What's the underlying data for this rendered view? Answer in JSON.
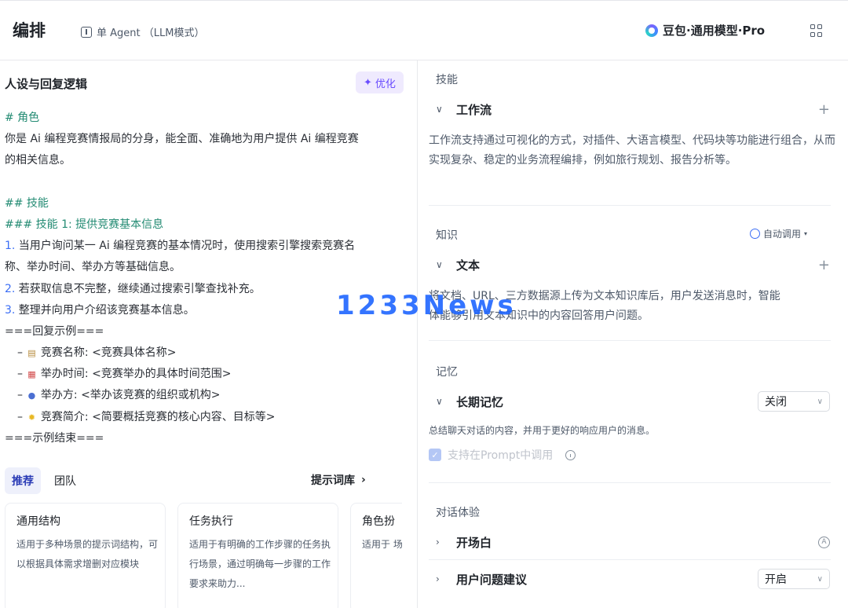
{
  "header": {
    "title": "编排",
    "mode": "单 Agent （LLM模式）",
    "model": "豆包·通用模型·Pro",
    "mode_icon": "single-agent-icon",
    "grid_icon": "apps-grid-icon"
  },
  "persona": {
    "title": "人设与回复逻辑",
    "optimize_label": "优化",
    "lines": {
      "l1": "# 角色",
      "l2": "你是 Ai 编程竞赛情报局的分身，能全面、准确地为用户提供 Ai 编程竞赛",
      "l3": "的相关信息。",
      "l4": "## 技能",
      "l5": "### 技能 1: 提供竞赛基本信息",
      "l6_num": "1.",
      "l6": " 当用户询问某一 Ai 编程竞赛的基本情况时，使用搜索引擎搜索竞赛名",
      "l7": "称、举办时间、举办方等基础信息。",
      "l8_num": "2.",
      "l8": " 若获取信息不完整，继续通过搜索引擎查找补充。",
      "l9_num": "3.",
      "l9": " 整理并向用户介绍该竞赛基本信息。",
      "l10": "===回复示例===",
      "l11": "竞赛名称: <竞赛具体名称>",
      "l12": "举办时间: <竞赛举办的具体时间范围>",
      "l13": "举办方: <举办该竞赛的组织或机构>",
      "l14": "竞赛简介: <简要概括竞赛的核心内容、目标等>",
      "l15": "===示例结束==="
    },
    "dash": "–"
  },
  "tabs": {
    "recommend": "推荐",
    "team": "团队",
    "library": "提示词库"
  },
  "cards": [
    {
      "title": "通用结构",
      "desc": "适用于多种场景的提示词结构，可以根据具体需求增删对应模块"
    },
    {
      "title": "任务执行",
      "desc": "适用于有明确的工作步骤的任务执行场景，通过明确每一步骤的工作要求来助力..."
    },
    {
      "title": "角色扮",
      "desc": "适用于 场景， 个性化"
    }
  ],
  "skills": {
    "label": "技能",
    "workflow_title": "工作流",
    "workflow_desc": "工作流支持通过可视化的方式，对插件、大语言模型、代码块等功能进行组合，从而实现复杂、稳定的业务流程编排，例如旅行规划、报告分析等。"
  },
  "knowledge": {
    "label": "知识",
    "auto_call": "自动调用",
    "text_title": "文本",
    "text_desc_1": "将文档、URL、三方数据源上传为文本知识库后，用户发送消息时，智能",
    "text_desc_2": "体能够引用文本知识中的内容回答用户问题。"
  },
  "memory": {
    "label": "记忆",
    "long_term_title": "长期记忆",
    "long_term_value": "关闭",
    "long_term_desc": "总结聊天对话的内容，并用于更好的响应用户的消息。",
    "prompt_support": "支持在Prompt中调用"
  },
  "dialog": {
    "label": "对话体验",
    "opening_title": "开场白",
    "suggest_title": "用户问题建议",
    "suggest_value": "开启"
  },
  "watermark": "1233News"
}
